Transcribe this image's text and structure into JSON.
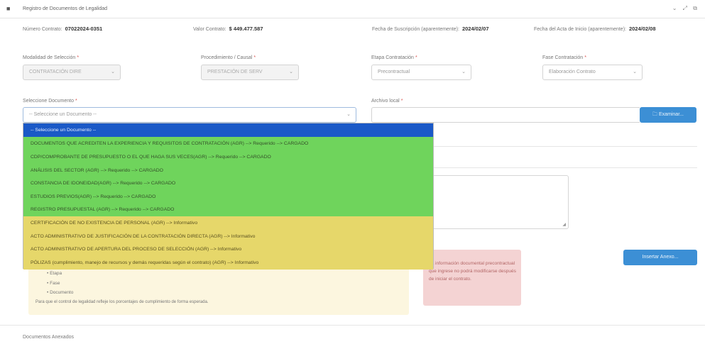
{
  "window": {
    "title": "Registro de Documentos de Legalidad",
    "controls": "⌄ ⤢ ⧉"
  },
  "info": {
    "contract_number_label": "Número Contrato:",
    "contract_number": "07022024-0351",
    "contract_value_label": "Valor Contrato:",
    "contract_value": "$ 449.477.587",
    "subscription_date_label": "Fecha de Suscripción (aparentemente):",
    "subscription_date": "2024/02/07",
    "start_date_label": "Fecha del Acta de Inicio (aparentemente):",
    "start_date": "2024/02/08"
  },
  "fields": {
    "modalidad": {
      "label": "Modalidad de Selección",
      "value": "CONTRATACIÓN DIRE"
    },
    "procedimiento": {
      "label": "Procedimiento / Causal",
      "value": "PRESTACIÓN DE SERV"
    },
    "etapa": {
      "label": "Etapa Contratación",
      "value": "Precontractual"
    },
    "fase": {
      "label": "Fase Contratación",
      "value": "Elaboración Contrato"
    },
    "documento": {
      "label": "Seleccione Documento",
      "value": "-- Seleccione un Documento --"
    },
    "archivo": {
      "label": "Archivo local",
      "button": "Examinar..."
    }
  },
  "dropdown_options": [
    "-- Seleccione un Documento --",
    "DOCUMENTOS QUE ACREDITEN LA EXPERIENCIA Y REQUISITOS DE CONTRATACIÓN (AGR) --> Requerido --> CARGADO",
    "CDP/COMPROBANTE DE PRESUPUESTO O EL QUE HAGA SUS VECES(AGR) --> Requerido --> CARGADO",
    "ANÁLISIS DEL SECTOR (AGR) --> Requerido --> CARGADO",
    "CONSTANCIA DE IDONEIDAD(AGR) --> Requerido --> CARGADO",
    "ESTUDIOS PREVIOS(AGR) --> Requerido --> CARGADO",
    "REGISTRO PRESUPUESTAL (AGR) --> Requerido --> CARGADO",
    "CERTIFICACIÓN DE NO EXISTENCIA DE PERSONAL (AGR) --> Informativo",
    "ACTO ADMINISTRATIVO DE JUSTIFICACIÓN DE LA CONTRATACIÓN DIRECTA (AGR) --> Informativo",
    "ACTO ADMINISTRATIVO DE APERTURA DEL PROCESO DE SELECCIÓN (AGR) --> Informativo",
    "PÓLIZAS (cumplimiento, manejo de recursos y demás requeridas según el contrato) (AGR) --> Informativo"
  ],
  "info_panel": {
    "items": [
      "Etapa",
      "Fase",
      "Documento"
    ],
    "note": "Para que el control de legalidad refleje los porcentajes de cumplimiento de forma esperada."
  },
  "alert": {
    "text": "La información documental precontractual que ingrese no podrá modificarse después de iniciar el contrato."
  },
  "buttons": {
    "insert": "Insertar Anexo..."
  },
  "footer": {
    "anexados": "Documentos Anexados"
  },
  "colors": {
    "selected": "#1a59c7",
    "required_loaded": "#6fd45c",
    "informative": "#e6d76a",
    "primary": "#3c8fd5"
  }
}
